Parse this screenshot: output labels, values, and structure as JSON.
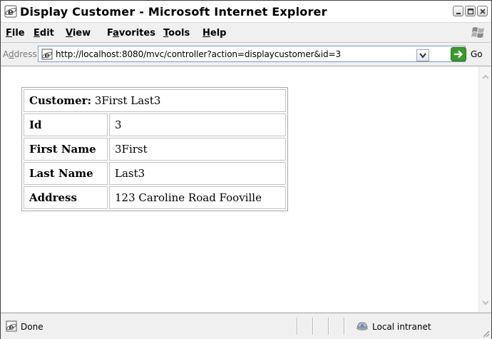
{
  "window": {
    "title": "Display Customer - Microsoft Internet Explorer"
  },
  "menu": {
    "items": [
      {
        "label": "File",
        "mnemonic": "F",
        "rest": "ile"
      },
      {
        "label": "Edit",
        "mnemonic": "E",
        "rest": "dit"
      },
      {
        "label": "View",
        "mnemonic": "V",
        "rest": "iew"
      },
      {
        "label": "Favorites",
        "mnemonic": "a",
        "pre": "F",
        "rest": "vorites"
      },
      {
        "label": "Tools",
        "mnemonic": "T",
        "rest": "ools"
      },
      {
        "label": "Help",
        "mnemonic": "H",
        "rest": "elp"
      }
    ]
  },
  "address": {
    "label_pre": "A",
    "label_mnemonic": "d",
    "label_rest": "dress",
    "url": "http://localhost:8080/mvc/controller?action=displaycustomer&id=3",
    "go_label": "Go"
  },
  "customer": {
    "header_label": "Customer:",
    "header_value": "3First Last3",
    "rows": [
      {
        "label": "Id",
        "value": "3"
      },
      {
        "label": "First Name",
        "value": "3First"
      },
      {
        "label": "Last Name",
        "value": "Last3"
      },
      {
        "label": "Address",
        "value": "123 Caroline Road Fooville"
      }
    ]
  },
  "status": {
    "text": "Done",
    "zone": "Local intranet"
  },
  "icons": {
    "app": "ie-icon",
    "page": "ie-page-icon",
    "go": "go-arrow-icon",
    "zone": "local-intranet-icon",
    "throbber": "windows-flag-icon"
  },
  "colors": {
    "go_button": "#3a9a2a",
    "address_border": "#7f9db9"
  }
}
